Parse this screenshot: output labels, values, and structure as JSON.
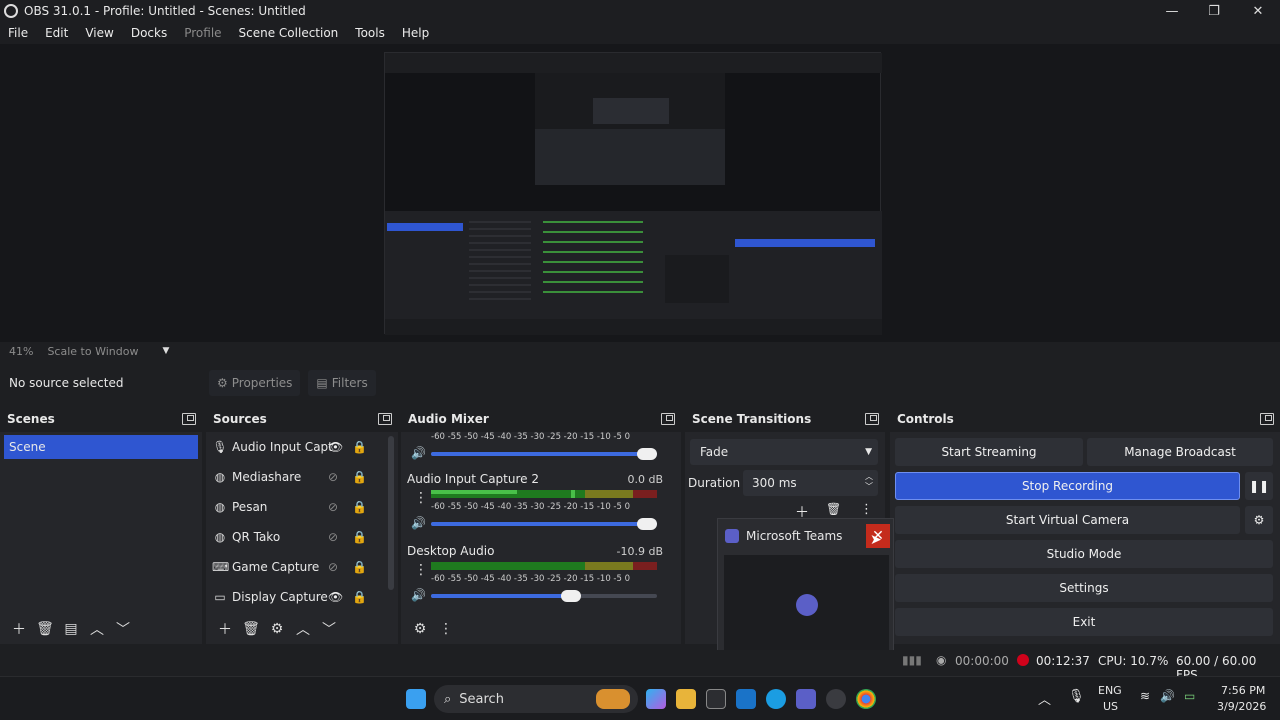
{
  "window": {
    "title": "OBS 31.0.1 - Profile: Untitled - Scenes: Untitled",
    "minimize": "—",
    "maximize": "❐",
    "close": "✕"
  },
  "menu": [
    "File",
    "Edit",
    "View",
    "Docks",
    "Profile",
    "Scene Collection",
    "Tools",
    "Help"
  ],
  "zoom": {
    "percent": "41%",
    "mode": "Scale to Window"
  },
  "source_bar": {
    "no_source": "No source selected",
    "properties": "Properties",
    "filters": "Filters"
  },
  "scenes": {
    "title": "Scenes",
    "items": [
      "Scene"
    ]
  },
  "sources": {
    "title": "Sources",
    "items": [
      {
        "name": "Audio Input Capt",
        "icon": "microphone-icon",
        "visible": true
      },
      {
        "name": "Mediashare",
        "icon": "globe-icon",
        "visible": false
      },
      {
        "name": "Pesan",
        "icon": "globe-icon",
        "visible": false
      },
      {
        "name": "QR Tako",
        "icon": "globe-icon",
        "visible": false
      },
      {
        "name": "Game Capture",
        "icon": "gamepad-icon",
        "visible": false
      },
      {
        "name": "Display Capture",
        "icon": "monitor-icon",
        "visible": true
      }
    ]
  },
  "audio_mixer": {
    "title": "Audio Mixer",
    "ticks": "-60 -55 -50 -45 -40 -35 -30 -25 -20 -15 -10 -5 0",
    "channels": [
      {
        "name": "Audio Input Capture 2",
        "db": "0.0 dB",
        "level": 0.5,
        "volume": 1.0
      },
      {
        "name": "Desktop Audio",
        "db": "-10.9 dB",
        "level": 0.0,
        "volume": 0.62
      }
    ]
  },
  "scene_transitions": {
    "title": "Scene Transitions",
    "transition": "Fade",
    "duration_label": "Duration",
    "duration": "300 ms"
  },
  "controls": {
    "title": "Controls",
    "start_streaming": "Start Streaming",
    "manage_broadcast": "Manage Broadcast",
    "stop_recording": "Stop Recording",
    "start_virtual_camera": "Start Virtual Camera",
    "studio_mode": "Studio Mode",
    "settings": "Settings",
    "exit": "Exit"
  },
  "teams_popup": {
    "title": "Microsoft Teams"
  },
  "status": {
    "stream_time": "00:00:00",
    "rec_time": "00:12:37",
    "cpu": "CPU: 10.7%",
    "fps": "60.00 / 60.00 FPS"
  },
  "taskbar": {
    "search": "Search",
    "lang": "ENG",
    "region": "US",
    "time": "7:56 PM",
    "date": "3/9/2026"
  },
  "colors": {
    "accent": "#2f56d1",
    "record": "#d0021b",
    "close": "#c42b1c"
  }
}
